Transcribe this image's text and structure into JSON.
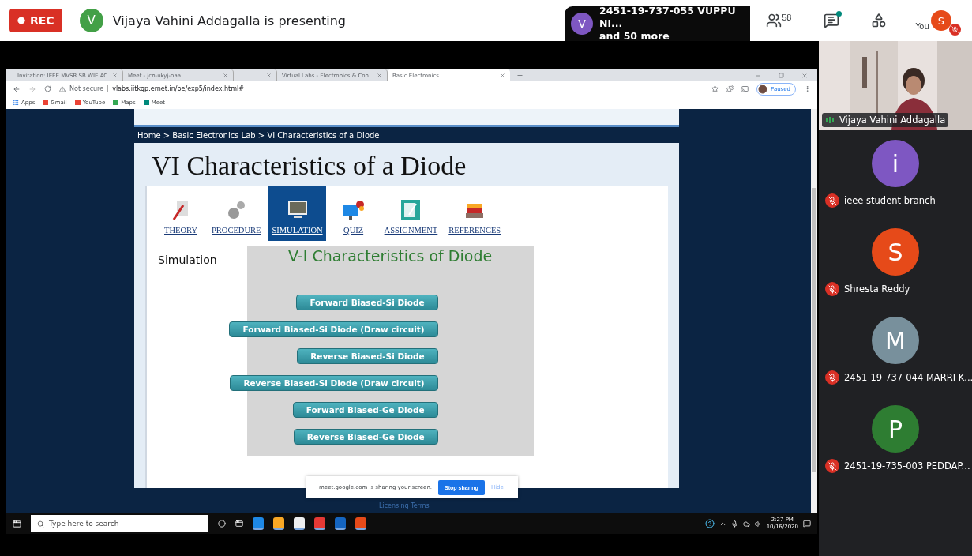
{
  "meet": {
    "recording_label": "REC",
    "presenter": {
      "initial": "V",
      "color": "#43a047",
      "text": "Vijaya Vahini Addagalla is presenting"
    },
    "presenters_popup": {
      "initial": "V",
      "color": "#7e57c2",
      "line1": "2451-19-737-055 VUPPU NI...",
      "line2": "and 50 more"
    },
    "participant_count": "58",
    "chat_unread": true,
    "self": {
      "label": "You",
      "initial": "S",
      "color": "#e64a19",
      "muted": true
    }
  },
  "browser": {
    "tabs": [
      {
        "title": "Invitation: IEEE MVSR SB WIE AC",
        "selected": false
      },
      {
        "title": "Meet - jcn-ukyj-oaa",
        "selected": false
      },
      {
        "selected": false
      },
      {
        "title": "Virtual Labs - Electronics & Con",
        "selected": false
      },
      {
        "title": "Basic Electronics",
        "selected": true
      }
    ],
    "security": "Not secure",
    "url": "vlabs.iitkgp.ernet.in/be/exp5/index.html#",
    "profile_status": "Paused",
    "bookmarks": [
      "Apps",
      "Gmail",
      "YouTube",
      "Maps",
      "Meet"
    ]
  },
  "page": {
    "breadcrumb": "Home > Basic Electronics Lab > VI Characteristics of a Diode",
    "title": "VI Characteristics of a Diode",
    "nav": [
      {
        "label": "THEORY",
        "selected": false
      },
      {
        "label": "PROCEDURE",
        "selected": false
      },
      {
        "label": "SIMULATION",
        "selected": true
      },
      {
        "label": "QUIZ",
        "selected": false
      },
      {
        "label": "ASSIGNMENT",
        "selected": false
      },
      {
        "label": "REFERENCES",
        "selected": false
      }
    ],
    "section_label": "Simulation",
    "simulation": {
      "title": "V-I Characteristics of Diode",
      "buttons": [
        "Forward Biased-Si Diode",
        "Forward Biased-Si Diode (Draw circuit)",
        "Reverse Biased-Si Diode",
        "Reverse Biased-Si Diode (Draw circuit)",
        "Forward Biased-Ge Diode",
        "Reverse Biased-Ge Diode"
      ]
    },
    "footer": "Licensing Terms"
  },
  "share_bar": {
    "message": "meet.google.com is sharing your screen.",
    "stop": "Stop sharing",
    "hide": "Hide"
  },
  "taskbar": {
    "search_placeholder": "Type here to search",
    "time": "2:27 PM",
    "date": "10/16/2020"
  },
  "participants": [
    {
      "kind": "picture",
      "name": "Vijaya Vahini Addagalla",
      "muted": false
    },
    {
      "kind": "avatar",
      "initial": "i",
      "color": "#7e57c2",
      "name": "ieee student branch",
      "muted": true
    },
    {
      "kind": "avatar",
      "initial": "S",
      "color": "#e64a19",
      "name": "Shresta Reddy",
      "muted": true
    },
    {
      "kind": "avatar",
      "initial": "M",
      "color": "#78909c",
      "name": "2451-19-737-044 MARRI K...",
      "muted": true
    },
    {
      "kind": "avatar",
      "initial": "P",
      "color": "#2e7d32",
      "name": "2451-19-735-003 PEDDAP...",
      "muted": true
    }
  ]
}
